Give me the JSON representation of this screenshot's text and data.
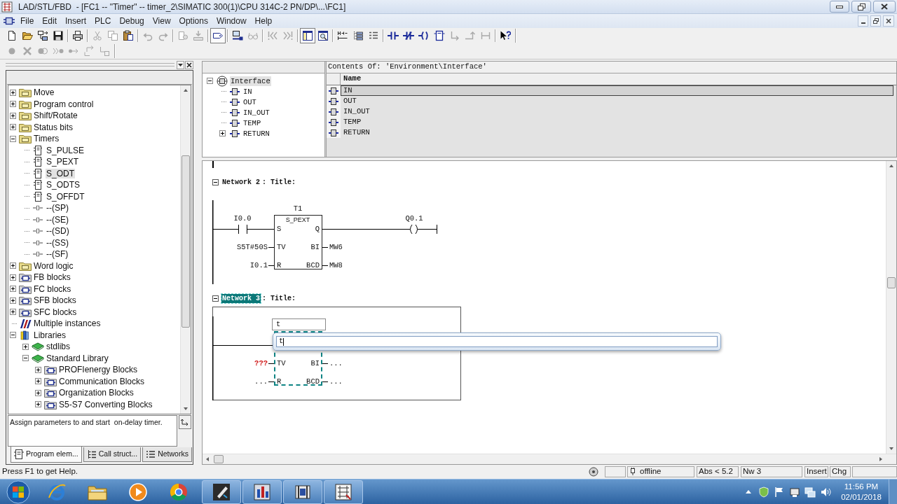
{
  "window": {
    "title": "LAD/STL/FBD  - [FC1 -- \"Timer\" -- timer_2\\SIMATIC 300(1)\\CPU 314C-2 PN/DP\\...\\FC1]"
  },
  "menu": {
    "items": [
      "File",
      "Edit",
      "Insert",
      "PLC",
      "Debug",
      "View",
      "Options",
      "Window",
      "Help"
    ]
  },
  "toolbar": [
    [
      {
        "disabled": false,
        "pressed": false
      },
      {
        "disabled": false,
        "pressed": false
      },
      {
        "disabled": false,
        "pressed": false
      },
      {
        "disabled": false,
        "pressed": false
      }
    ],
    [
      {
        "disabled": false,
        "pressed": false
      }
    ],
    [
      {
        "disabled": true,
        "pressed": false
      },
      {
        "disabled": true,
        "pressed": false
      },
      {
        "disabled": false,
        "pressed": false
      }
    ],
    [
      {
        "disabled": true,
        "pressed": false
      },
      {
        "disabled": true,
        "pressed": false
      }
    ],
    [
      {
        "disabled": true,
        "pressed": false
      },
      {
        "disabled": true,
        "pressed": false
      }
    ],
    [
      {
        "disabled": false,
        "pressed": true
      }
    ],
    [
      {
        "disabled": false,
        "pressed": false
      },
      {
        "disabled": true,
        "pressed": false
      }
    ],
    [
      {
        "disabled": true,
        "pressed": false
      },
      {
        "disabled": true,
        "pressed": false
      }
    ],
    [
      {
        "disabled": false,
        "pressed": true
      },
      {
        "disabled": false,
        "pressed": false
      }
    ],
    [
      {
        "disabled": false,
        "pressed": false
      },
      {
        "disabled": false,
        "pressed": false
      },
      {
        "disabled": false,
        "pressed": false
      }
    ],
    [
      {
        "disabled": false,
        "pressed": false
      },
      {
        "disabled": false,
        "pressed": false
      },
      {
        "disabled": false,
        "pressed": false
      },
      {
        "disabled": false,
        "pressed": false
      },
      {
        "disabled": true,
        "pressed": false
      },
      {
        "disabled": true,
        "pressed": false
      },
      {
        "disabled": true,
        "pressed": false
      }
    ],
    [
      {
        "disabled": false,
        "pressed": false
      }
    ]
  ],
  "debug_toolbar": [
    [
      {
        "disabled": true,
        "pressed": false
      },
      {
        "disabled": true,
        "pressed": false
      },
      {
        "disabled": true,
        "pressed": false
      },
      {
        "disabled": true,
        "pressed": false
      },
      {
        "disabled": true,
        "pressed": false
      },
      {
        "disabled": true,
        "pressed": false
      },
      {
        "disabled": true,
        "pressed": false
      }
    ]
  ],
  "program_elements": {
    "tree": [
      {
        "label": "Move",
        "kind": "category",
        "expanded": false,
        "selected": false
      },
      {
        "label": "Program control",
        "kind": "category",
        "expanded": false,
        "selected": false
      },
      {
        "label": "Shift/Rotate",
        "kind": "category",
        "expanded": false,
        "selected": false
      },
      {
        "label": "Status bits",
        "kind": "category",
        "expanded": false,
        "selected": false
      },
      {
        "label": "Timers",
        "kind": "category",
        "expanded": true,
        "selected": false,
        "children": [
          {
            "label": "S_PULSE",
            "kind": "box",
            "selected": false
          },
          {
            "label": "S_PEXT",
            "kind": "box",
            "selected": false
          },
          {
            "label": "S_ODT",
            "kind": "box",
            "selected": true
          },
          {
            "label": "S_ODTS",
            "kind": "box",
            "selected": false
          },
          {
            "label": "S_OFFDT",
            "kind": "box",
            "selected": false
          },
          {
            "label": "--(SP)",
            "kind": "coil",
            "selected": false
          },
          {
            "label": "--(SE)",
            "kind": "coil",
            "selected": false
          },
          {
            "label": "--(SD)",
            "kind": "coil",
            "selected": false
          },
          {
            "label": "--(SS)",
            "kind": "coil",
            "selected": false
          },
          {
            "label": "--(SF)",
            "kind": "coil",
            "selected": false
          }
        ]
      },
      {
        "label": "Word logic",
        "kind": "category",
        "expanded": false,
        "selected": false
      },
      {
        "label": "FB blocks",
        "kind": "block-category",
        "expanded": false,
        "selected": false
      },
      {
        "label": "FC blocks",
        "kind": "block-category",
        "expanded": false,
        "selected": false
      },
      {
        "label": "SFB blocks",
        "kind": "block-category",
        "expanded": false,
        "selected": false
      },
      {
        "label": "SFC blocks",
        "kind": "block-category",
        "expanded": false,
        "selected": false
      },
      {
        "label": "Multiple instances",
        "kind": "instances",
        "selected": false
      },
      {
        "label": "Libraries",
        "kind": "libraries",
        "expanded": true,
        "selected": false,
        "children": [
          {
            "label": "stdlibs",
            "kind": "library",
            "expanded": false,
            "selected": false
          },
          {
            "label": "Standard Library",
            "kind": "library",
            "expanded": true,
            "selected": false,
            "children": [
              {
                "label": "PROFIenergy Blocks",
                "kind": "block-category",
                "expanded": false,
                "selected": false
              },
              {
                "label": "Communication Blocks",
                "kind": "block-category",
                "expanded": false,
                "selected": false
              },
              {
                "label": "Organization Blocks",
                "kind": "block-category",
                "expanded": false,
                "selected": false
              },
              {
                "label": "S5-S7 Converting Blocks",
                "kind": "block-category",
                "expanded": false,
                "selected": false
              }
            ]
          }
        ]
      }
    ],
    "description": "Assign parameters to and start  on-delay timer.",
    "tabs": [
      {
        "label": "Program elem...",
        "selected": true
      },
      {
        "label": "Call struct...",
        "selected": false
      },
      {
        "label": "Networks",
        "selected": false
      }
    ]
  },
  "interface": {
    "tree": [
      {
        "label": "Interface",
        "kind": "root",
        "expanded": true,
        "selected": true,
        "children": [
          {
            "label": "IN",
            "kind": "parameter",
            "selected": false
          },
          {
            "label": "OUT",
            "kind": "parameter",
            "selected": false
          },
          {
            "label": "IN_OUT",
            "kind": "parameter",
            "selected": false
          },
          {
            "label": "TEMP",
            "kind": "parameter",
            "selected": false
          },
          {
            "label": "RETURN",
            "kind": "parameter",
            "expanded": false,
            "selected": false
          }
        ]
      }
    ],
    "contents_header": "Contents Of: 'Environment\\Interface'",
    "column": "Name",
    "rows": [
      {
        "name": "IN",
        "selected": true
      },
      {
        "name": "OUT",
        "selected": false
      },
      {
        "name": "IN_OUT",
        "selected": false
      },
      {
        "name": "TEMP",
        "selected": false
      },
      {
        "name": "RETURN",
        "selected": false
      }
    ]
  },
  "editor": {
    "networks": [
      {
        "label": "Network 2",
        "title": ": Title:",
        "expanded": true,
        "selected": false,
        "contact": {
          "operand": "I0.0"
        },
        "block": {
          "instance": "T1",
          "type": "S_PEXT",
          "selected": false,
          "inputs": [
            {
              "pin": "S"
            },
            {
              "pin": "TV",
              "operand": "S5T#50S",
              "missing": false
            },
            {
              "pin": "R",
              "operand": "I0.1",
              "missing": false
            }
          ],
          "outputs": [
            {
              "pin": "Q"
            },
            {
              "pin": "BI",
              "operand": "MW6"
            },
            {
              "pin": "BCD",
              "operand": "MW8"
            }
          ]
        },
        "coil": {
          "operand": "Q0.1"
        }
      },
      {
        "label": "Network 3",
        "title": ": Title:",
        "expanded": true,
        "selected": true,
        "block": {
          "name_field": "t",
          "selected": true,
          "inputs": [
            {
              "pin": "TV",
              "operand": "???",
              "missing": true
            },
            {
              "pin": "R",
              "operand": "...",
              "missing": false
            }
          ],
          "outputs": [
            {
              "pin": "BI",
              "operand": "..."
            },
            {
              "pin": "BCD",
              "operand": "..."
            }
          ]
        }
      }
    ],
    "autocomplete": {
      "value": "t"
    }
  },
  "status_bar": {
    "help": "Press F1 to get Help.",
    "mode": "offline",
    "address": "Abs < 5.2",
    "network": "Nw 3",
    "insert_mode": "Insert",
    "changed": "Chg"
  },
  "taskbar": {
    "time": "11:56 PM",
    "date": "02/01/2018"
  }
}
